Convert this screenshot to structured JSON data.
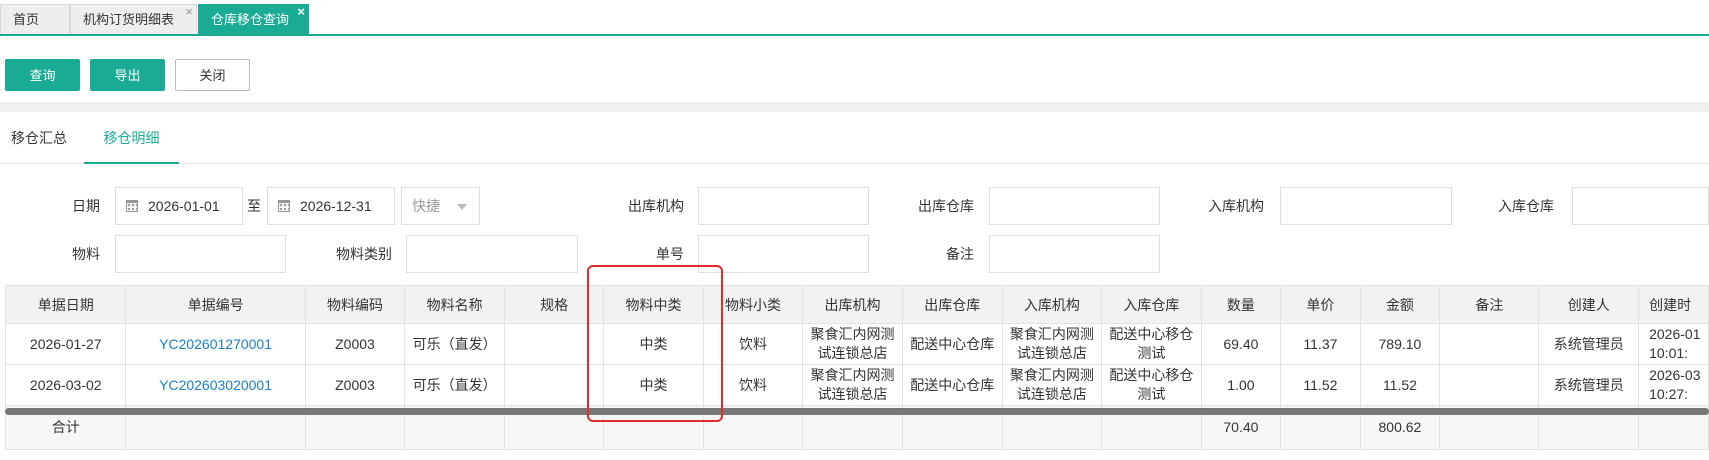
{
  "tabs": [
    {
      "label": "首页"
    },
    {
      "label": "机构订货明细表",
      "close": "×"
    },
    {
      "label": "仓库移仓查询",
      "close": "×"
    }
  ],
  "toolbar": {
    "query": "查询",
    "export": "导出",
    "close": "关闭"
  },
  "subtabs": {
    "summary": "移仓汇总",
    "detail": "移仓明细"
  },
  "filters": {
    "date_label": "日期",
    "date_from": "2026-01-01",
    "date_to_sep": "至",
    "date_to": "2026-12-31",
    "quick": "快捷",
    "out_org_label": "出库机构",
    "out_wh_label": "出库仓库",
    "in_org_label": "入库机构",
    "in_wh_label": "入库仓库",
    "material_label": "物料",
    "material_cat_label": "物料类别",
    "bill_no_label": "单号",
    "remark_label": "备注"
  },
  "table": {
    "headers": [
      "单据日期",
      "单据编号",
      "物料编码",
      "物料名称",
      "规格",
      "物料中类",
      "物料小类",
      "出库机构",
      "出库仓库",
      "入库机构",
      "入库仓库",
      "数量",
      "单价",
      "金额",
      "备注",
      "创建人",
      "创建时"
    ],
    "rows": [
      [
        "2026-01-27",
        "YC202601270001",
        "Z0003",
        "可乐（直发）",
        "",
        "中类",
        "饮料",
        "聚食汇内网测试连锁总店",
        "配送中心仓库",
        "聚食汇内网测试连锁总店",
        "配送中心移仓测试",
        "69.40",
        "11.37",
        "789.10",
        "",
        "系统管理员",
        "2026-01 10:01:"
      ],
      [
        "2026-03-02",
        "YC202603020001",
        "Z0003",
        "可乐（直发）",
        "",
        "中类",
        "饮料",
        "聚食汇内网测试连锁总店",
        "配送中心仓库",
        "聚食汇内网测试连锁总店",
        "配送中心移仓测试",
        "1.00",
        "11.52",
        "11.52",
        "",
        "系统管理员",
        "2026-03 10:27:"
      ]
    ],
    "total": [
      "合计",
      "",
      "",
      "",
      "",
      "",
      "",
      "",
      "",
      "",
      "",
      "70.40",
      "",
      "800.62",
      "",
      "",
      ""
    ]
  }
}
